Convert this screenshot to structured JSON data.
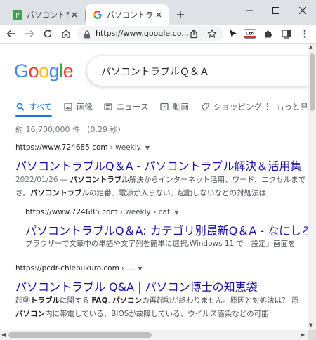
{
  "tabs": [
    {
      "title": "パソコントラブルQ＆",
      "favicon": "green-site-favicon",
      "color": "#3fa34d"
    },
    {
      "title": "パソコントラブルQ＆",
      "favicon": "google-g-favicon"
    }
  ],
  "toolbar": {
    "url": "https://www.google.co...",
    "icons": [
      "back-arrow-icon",
      "forward-arrow-icon",
      "reload-icon",
      "home-icon",
      "lock-icon",
      "share-icon",
      "bookmark-star-icon",
      "cursor-extension-icon",
      "ctrl-extension-icon",
      "puzzle-extensions-icon",
      "sidepanel-icon",
      "menu-dots-icon"
    ],
    "ctrl_label": "Ctrl"
  },
  "google": {
    "logo_letters": [
      "G",
      "o",
      "o",
      "g",
      "l",
      "e"
    ],
    "logo_colors": [
      "#4285F4",
      "#EA4335",
      "#FBBC05",
      "#4285F4",
      "#34A853",
      "#EA4335"
    ],
    "query": "パソコントラブルＱ＆Ａ",
    "nav": [
      {
        "label": "すべて",
        "icon": "search-icon",
        "active": true
      },
      {
        "label": "画像",
        "icon": "image-icon"
      },
      {
        "label": "ニュース",
        "icon": "news-icon"
      },
      {
        "label": "動画",
        "icon": "video-play-icon"
      },
      {
        "label": "ショッピング",
        "icon": "tag-icon"
      },
      {
        "label": "もっと見",
        "icon": "more-dots-icon"
      }
    ],
    "stats": "約 16,700,000 件 （0.29 秒）"
  },
  "results": [
    {
      "site": "https://www.724685.com",
      "crumb": "› weekly",
      "title": "パソコントラブルQ＆A - パソコントラブル解決＆活用集",
      "date": "2022/01/26",
      "snippet_line1_prefix": " — ",
      "snippet_line1_bold": "パソコントラブル",
      "snippet_line1_rest": "解決からインターネット活用、ワード、エクセルまで",
      "snippet_line2_pre": "さ。",
      "snippet_line2_bold": "パソコントラブル",
      "snippet_line2_rest": "の定番、電源が入らない、起動しないなどの対処法は"
    },
    {
      "site": "https://www.724685.com",
      "crumb": "› weekly › cat",
      "title": "パソコントラブルQ＆A: カテゴリ別最新Q＆A - なにしろ",
      "snippet_line1": "ブラウザーで文章中の単語や文字列を簡単に選択,Windows 11 で「設定」画面を"
    },
    {
      "site": "https://pcdr-chiebukuro.com",
      "crumb": "› ...",
      "title": "パソコントラブル Q&A | パソコン博士の知恵袋",
      "snippet_line1_pre": "起動",
      "snippet_line1_bold1": "トラブル",
      "snippet_line1_mid": "に関する ",
      "snippet_line1_bold2": "FAQ",
      "snippet_line1_mid2": ". ",
      "snippet_line1_bold3": "パソコン",
      "snippet_line1_rest": "の再起動が終わりません。原因と対処法は？ 原",
      "snippet_line2_bold": "パソコン",
      "snippet_line2_rest": "内に帯電している、BIOSが故障している、ウイルス感染などの可能"
    }
  ]
}
